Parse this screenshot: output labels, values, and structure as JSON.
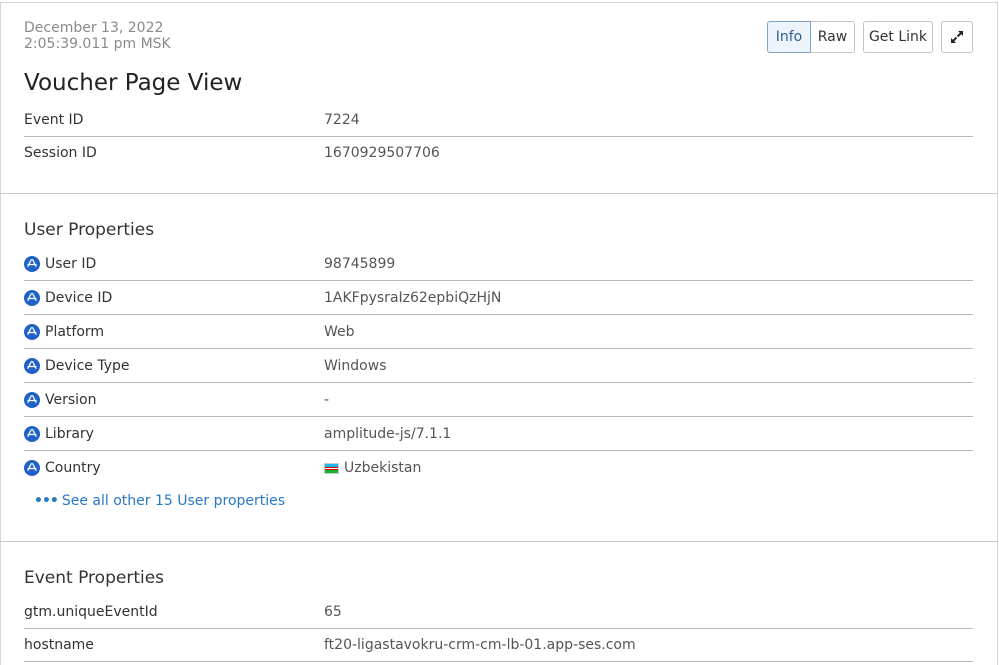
{
  "header": {
    "date": "December 13, 2022",
    "time": "2:05:39.011 pm MSK",
    "title": "Voucher Page View"
  },
  "toolbar": {
    "info_label": "Info",
    "raw_label": "Raw",
    "get_link_label": "Get Link",
    "expand_icon": "expand-icon",
    "active_tab": "Info"
  },
  "event_meta": [
    {
      "label": "Event ID",
      "value": "7224"
    },
    {
      "label": "Session ID",
      "value": "1670929507706"
    }
  ],
  "user_properties": {
    "title": "User Properties",
    "icon": "amplitude-icon",
    "items": [
      {
        "label": "User ID",
        "value": "98745899"
      },
      {
        "label": "Device ID",
        "value": "1AKFpysraIz62epbiQzHjN"
      },
      {
        "label": "Platform",
        "value": "Web"
      },
      {
        "label": "Device Type",
        "value": "Windows"
      },
      {
        "label": "Version",
        "value": "-"
      },
      {
        "label": "Library",
        "value": "amplitude-js/7.1.1"
      },
      {
        "label": "Country",
        "value": "Uzbekistan",
        "flag": "uz-flag-icon"
      }
    ],
    "see_all_label": "See all other 15 User properties"
  },
  "event_properties": {
    "title": "Event Properties",
    "items": [
      {
        "label": "gtm.uniqueEventId",
        "value": "65"
      },
      {
        "label": "hostname",
        "value": "ft20-ligastavokru-crm-cm-lb-01.app-ses.com"
      }
    ]
  },
  "colors": {
    "accent": "#2878c8",
    "icon_blue": "#1e62c7",
    "active_tab_bg": "#eef4fb"
  }
}
